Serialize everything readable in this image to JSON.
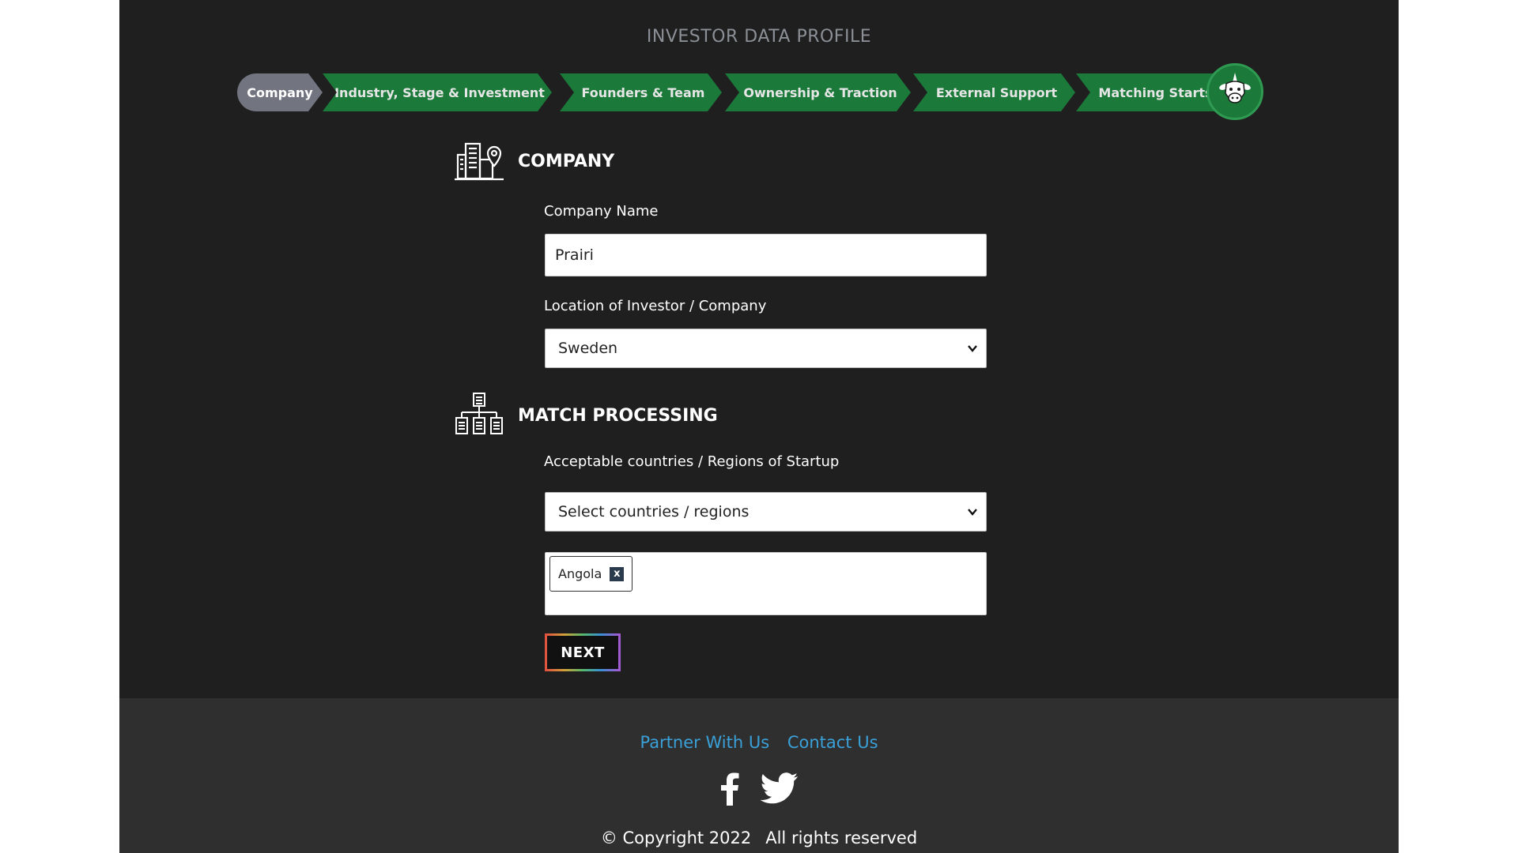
{
  "page": {
    "title": "INVESTOR DATA PROFILE"
  },
  "stepper": {
    "steps": [
      {
        "label": "Company",
        "active": true
      },
      {
        "label": "Industry, Stage & Investment",
        "active": false
      },
      {
        "label": "Founders & Team",
        "active": false
      },
      {
        "label": "Ownership & Traction",
        "active": false
      },
      {
        "label": "External Support",
        "active": false
      },
      {
        "label": "Matching Starts",
        "active": false
      }
    ],
    "mascot_icon": "unicorn-cow-icon"
  },
  "company_section": {
    "title": "COMPANY",
    "icon": "building-location-icon",
    "company_name_label": "Company Name",
    "company_name_value": "Prairi",
    "location_label": "Location of Investor / Company",
    "location_value": "Sweden"
  },
  "match_section": {
    "title": "MATCH PROCESSING",
    "icon": "org-chart-icon",
    "regions_label": "Acceptable countries / Regions of Startup",
    "regions_placeholder": "Select countries / regions",
    "selected_tags": [
      {
        "label": "Angola",
        "remove": "x"
      }
    ]
  },
  "actions": {
    "next_label": "NEXT"
  },
  "footer": {
    "links": [
      {
        "label": "Partner With Us"
      },
      {
        "label": "Contact Us"
      }
    ],
    "social": [
      "facebook-icon",
      "twitter-icon"
    ],
    "copyright": "© Copyright 2022",
    "rights": "All rights reserved"
  },
  "colors": {
    "step_green": "#1b7a3a",
    "step_active": "#727580",
    "link_blue": "#3aa0d8",
    "background": "#1f1f1f",
    "footer_bg": "#2f2f2f"
  }
}
